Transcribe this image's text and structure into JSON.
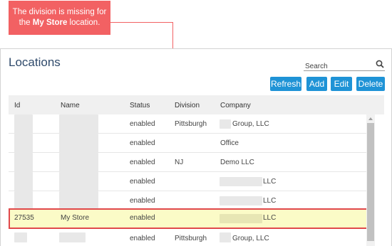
{
  "callout": {
    "line1": "The division is missing for",
    "line2_prefix": "the ",
    "line2_store": "My Store",
    "line2_suffix": " location.",
    "color": "#f26163"
  },
  "panel": {
    "title": "Locations"
  },
  "search": {
    "placeholder": "Search"
  },
  "toolbar": {
    "refresh_label": "Refresh",
    "add_label": "Add",
    "edit_label": "Edit",
    "delete_label": "Delete",
    "button_color": "#1f93d6"
  },
  "table": {
    "columns": [
      "Id",
      "Name",
      "Status",
      "Division",
      "Company"
    ],
    "rows": [
      {
        "id": "",
        "name": "",
        "status": "enabled",
        "division": "Pittsburgh",
        "company": "Group, LLC"
      },
      {
        "id": "",
        "name": "",
        "status": "enabled",
        "division": "",
        "company": "Office"
      },
      {
        "id": "",
        "name": "",
        "status": "enabled",
        "division": "NJ",
        "company": "Demo LLC"
      },
      {
        "id": "",
        "name": "",
        "status": "enabled",
        "division": "",
        "company": "LLC"
      },
      {
        "id": "",
        "name": "",
        "status": "enabled",
        "division": "",
        "company": "LLC"
      },
      {
        "id": "27535",
        "name": "My Store",
        "status": "enabled",
        "division": "",
        "company": "LLC"
      },
      {
        "id": "",
        "name": "",
        "status": "enabled",
        "division": "Pittsburgh",
        "company": "Group, LLC"
      }
    ]
  },
  "colors": {
    "highlight_bg": "#fbfbc7",
    "highlight_border": "#e0484b",
    "title": "#2f4a6b"
  }
}
